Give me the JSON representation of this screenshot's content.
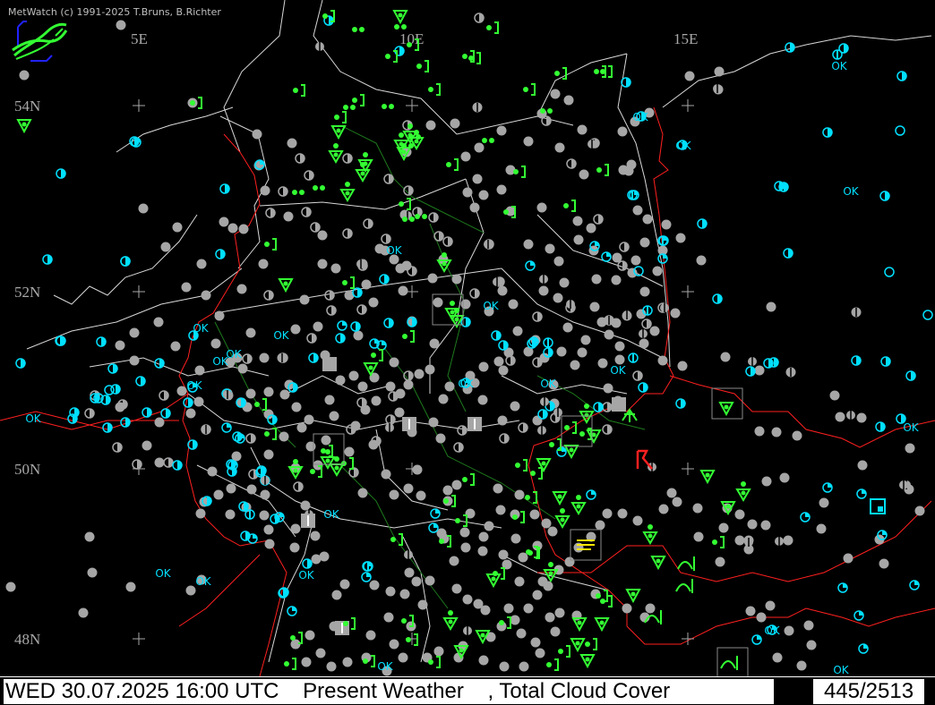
{
  "header": {
    "copyright": "MetWatch  (c) 1991-2025 T.Bruns, B.Richter"
  },
  "map": {
    "longitude_labels": [
      "5E",
      "10E",
      "15E"
    ],
    "latitude_labels": [
      "54N",
      "52N",
      "50N",
      "48N"
    ],
    "station_ok_label": "OK"
  },
  "footer": {
    "datetime": "WED 30.07.2025 16:00 UTC",
    "product": "Present Weather",
    "separator": ",",
    "overlay": "Total Cloud Cover",
    "station_count": "445/2513"
  },
  "colors": {
    "background": "#000000",
    "cloud_gray": "#a6a6a6",
    "cloud_cyan": "#00e0ff",
    "weather_green": "#33ff33",
    "border_red": "#ff2020",
    "coast_white": "#d8d8d8",
    "river_green": "#1e7a1e",
    "thunder_red": "#ff2020",
    "smoke_yellow": "#ffe800"
  }
}
